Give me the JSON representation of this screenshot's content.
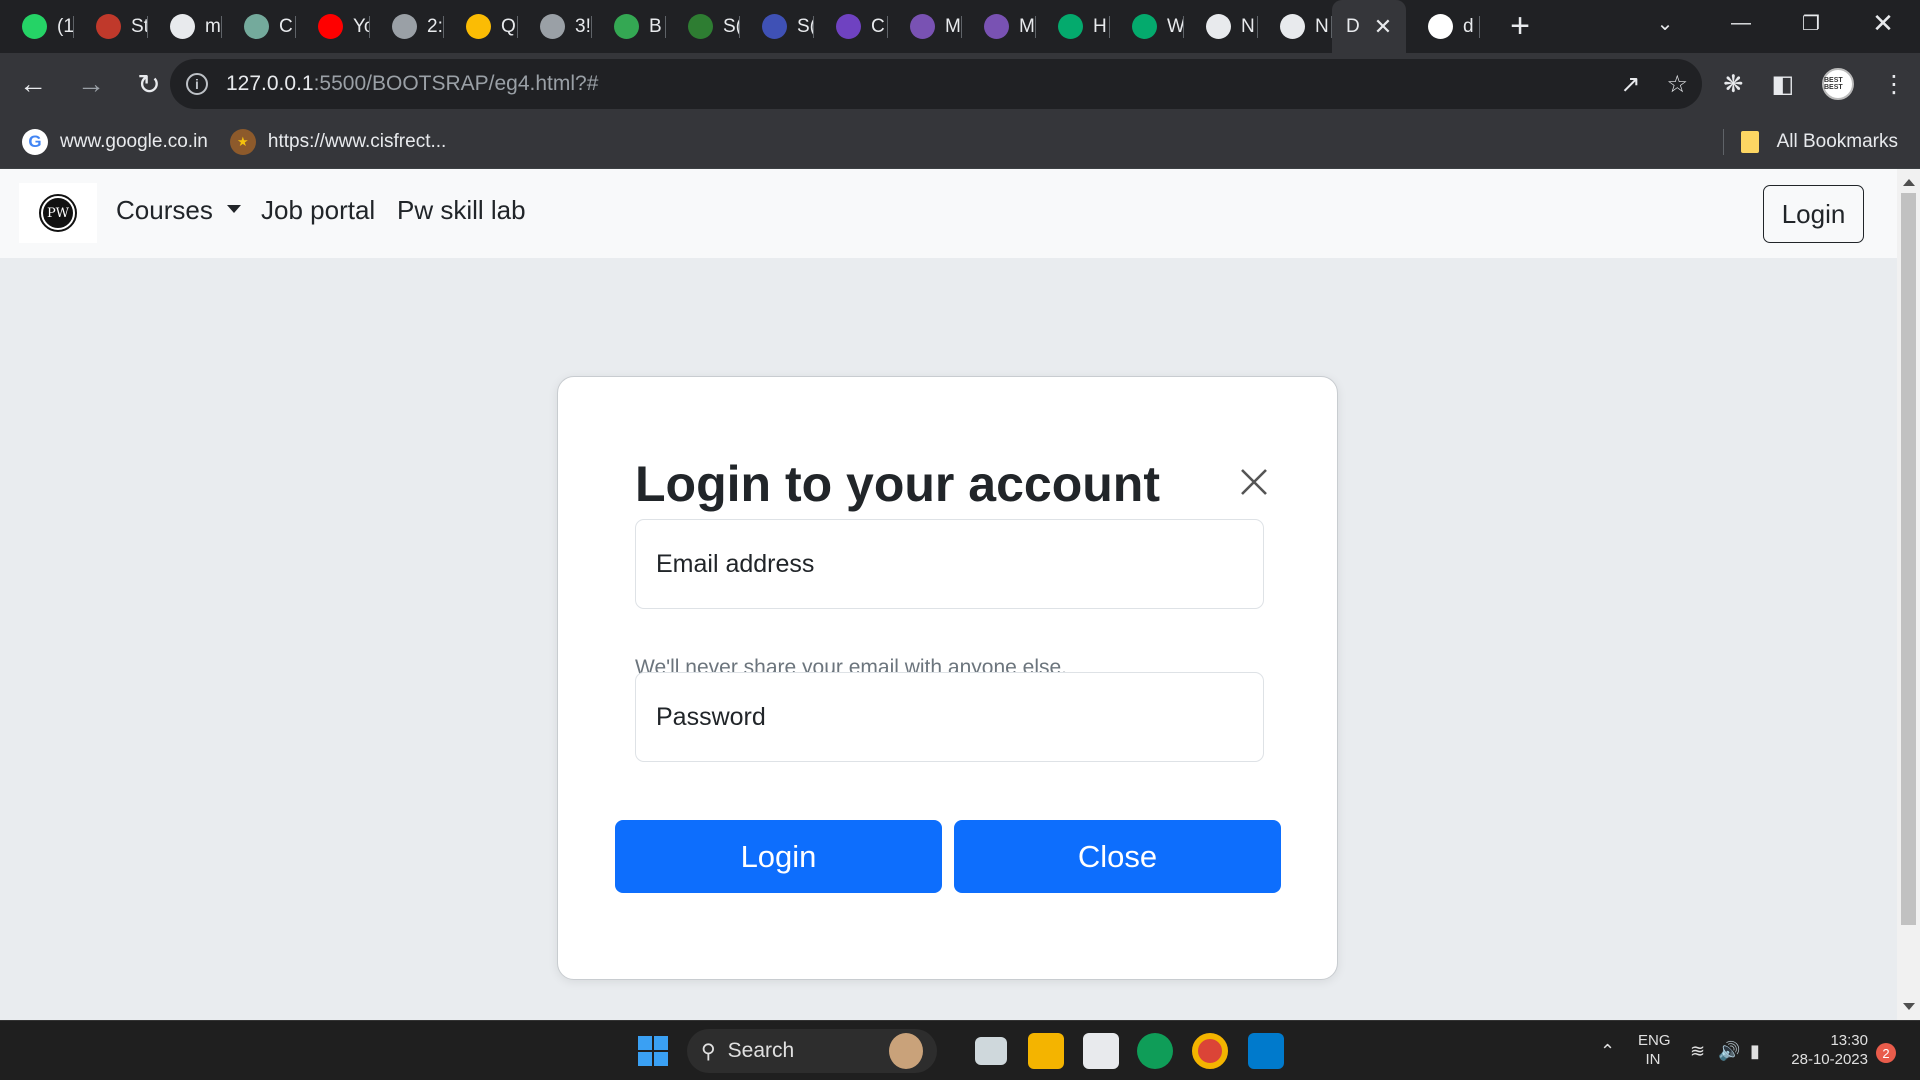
{
  "browser": {
    "tabs": [
      {
        "label": "(1",
        "icon": "whatsapp-icon",
        "color": "#25d366"
      },
      {
        "label": "St",
        "icon": "circle-logo-icon",
        "color": "#c0392b"
      },
      {
        "label": "m",
        "icon": "github-icon",
        "color": "#e8eaed"
      },
      {
        "label": "C",
        "icon": "chatgpt-icon",
        "color": "#74aa9c"
      },
      {
        "label": "Yo",
        "icon": "youtube-icon",
        "color": "#ff0000"
      },
      {
        "label": "2:",
        "icon": "wordpress-icon",
        "color": "#9aa0a6"
      },
      {
        "label": "Q",
        "icon": "drive-icon",
        "color": "#fbbc04"
      },
      {
        "label": "3!",
        "icon": "wordpress-icon",
        "color": "#9aa0a6"
      },
      {
        "label": "B",
        "icon": "drive-icon",
        "color": "#34a853"
      },
      {
        "label": "S(",
        "icon": "w-logo-icon",
        "color": "#2e7d32"
      },
      {
        "label": "S(",
        "icon": "pw-logo-icon",
        "color": "#3f51b5"
      },
      {
        "label": "C",
        "icon": "purple-logo-icon",
        "color": "#6f42c1"
      },
      {
        "label": "M",
        "icon": "bootstrap-icon",
        "color": "#7952b3"
      },
      {
        "label": "M",
        "icon": "bootstrap-icon",
        "color": "#7952b3"
      },
      {
        "label": "H",
        "icon": "w3schools-icon",
        "color": "#04aa6d"
      },
      {
        "label": "W",
        "icon": "w3schools-icon",
        "color": "#04aa6d"
      },
      {
        "label": "N",
        "icon": "chrome-icon",
        "color": "#e8eaed"
      },
      {
        "label": "N",
        "icon": "chrome-icon",
        "color": "#e8eaed"
      },
      {
        "label": "D",
        "icon": "",
        "color": "#35363a",
        "active": true
      },
      {
        "label": "d",
        "icon": "google-icon",
        "color": "#ffffff"
      }
    ],
    "url_host": "127.0.0.1",
    "url_rest": ":5500/BOOTSRAP/eg4.html?#",
    "bookmarks": [
      {
        "label": "www.google.co.in",
        "icon": "google-icon"
      },
      {
        "label": "https://www.cisfrect...",
        "icon": "emblem-icon"
      }
    ],
    "all_bookmarks": "All Bookmarks",
    "profile_text": "BEST BEST"
  },
  "page": {
    "navbar": {
      "brand": "PW",
      "links": [
        "Courses",
        "Job portal",
        "Pw skill lab"
      ],
      "login_label": "Login"
    },
    "modal": {
      "title": "Login to your account",
      "email_placeholder": "Email address",
      "email_help": "We'll never share your email with anyone else.",
      "password_placeholder": "Password",
      "login_label": "Login",
      "close_label": "Close"
    },
    "colors": {
      "primary": "#0d6efd",
      "navbar_bg": "#f8f9fa",
      "page_bg": "#e9ecef"
    }
  },
  "taskbar": {
    "search_label": "Search",
    "lang_top": "ENG",
    "lang_bottom": "IN",
    "time": "13:30",
    "date": "28-10-2023",
    "notifications": "2"
  }
}
